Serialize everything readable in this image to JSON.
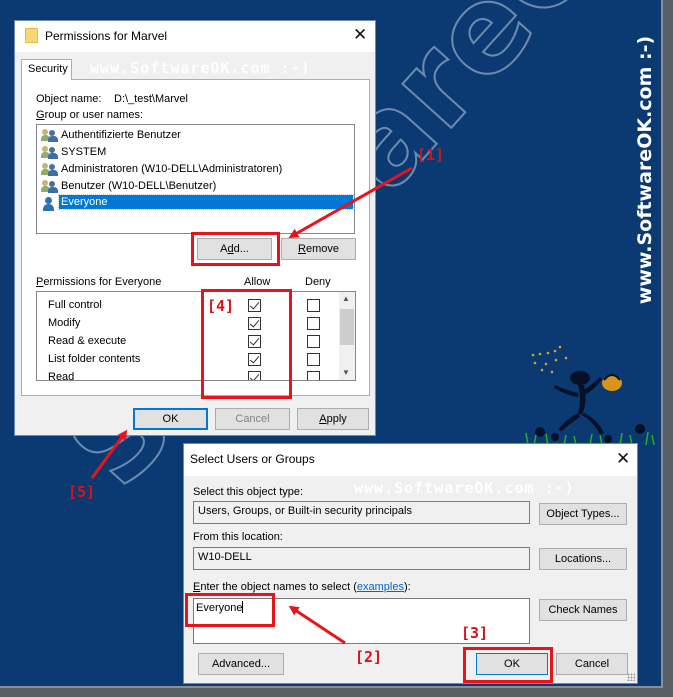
{
  "watermark": {
    "diagonal": "SoftwareOK.com",
    "vertical": "www.SoftwareOK.com :-)",
    "inline": "www.SoftwareOK.com :-)"
  },
  "permissions_dialog": {
    "title": "Permissions for Marvel",
    "close_label": "✕",
    "tab": "Security",
    "object_name_label": "Object name:",
    "object_name_value": "D:\\_test\\Marvel",
    "group_label_first": "G",
    "group_label_rest": "roup or user names:",
    "groups": [
      {
        "label": "Authentifizierte Benutzer",
        "icon": "group-icon",
        "selected": false
      },
      {
        "label": "SYSTEM",
        "icon": "group-icon",
        "selected": false
      },
      {
        "label": "Administratoren (W10-DELL\\Administratoren)",
        "icon": "group-icon",
        "selected": false
      },
      {
        "label": "Benutzer (W10-DELL\\Benutzer)",
        "icon": "group-icon",
        "selected": false
      },
      {
        "label": "Everyone",
        "icon": "user-icon",
        "selected": true
      }
    ],
    "add_button": {
      "pre": "A",
      "mid": "d",
      "post": "d..."
    },
    "remove_button": {
      "first": "R",
      "rest": "emove"
    },
    "permissions_label_first": "P",
    "permissions_label_rest": "ermissions for Everyone",
    "allow_header": "Allow",
    "deny_header": "Deny",
    "permissions": [
      {
        "name": "Full control",
        "allow": true,
        "deny": false
      },
      {
        "name": "Modify",
        "allow": true,
        "deny": false
      },
      {
        "name": "Read & execute",
        "allow": true,
        "deny": false
      },
      {
        "name": "List folder contents",
        "allow": true,
        "deny": false
      },
      {
        "name": "Read",
        "allow": true,
        "deny": false
      }
    ],
    "ok_button": "OK",
    "cancel_button": "Cancel",
    "apply_button": {
      "first": "A",
      "rest": "pply"
    }
  },
  "select_dialog": {
    "title": "Select Users or Groups",
    "close_label": "✕",
    "object_type_label": "Select this object type:",
    "object_type_value": "Users, Groups, or Built-in security principals",
    "object_types_button": "Object Types...",
    "location_label": "From this location:",
    "location_value": "W10-DELL",
    "locations_button": "Locations...",
    "enter_names_label_first": "E",
    "enter_names_label_rest": "nter the object names to select (",
    "examples_link": "examples",
    "enter_names_label_end": "):",
    "names_value": "Everyone",
    "check_names_button": "Check Names",
    "advanced_button": "Advanced...",
    "ok_button": "OK",
    "cancel_button": "Cancel"
  },
  "annotations": {
    "step1": "[1]",
    "step2": "[2]",
    "step3": "[3]",
    "step4": "[4]",
    "step5": "[5]",
    "color": "#e8141c"
  },
  "colors": {
    "background": "#0b3a72",
    "selection": "#0078d7",
    "dialog_bg": "#f0f0f0"
  }
}
